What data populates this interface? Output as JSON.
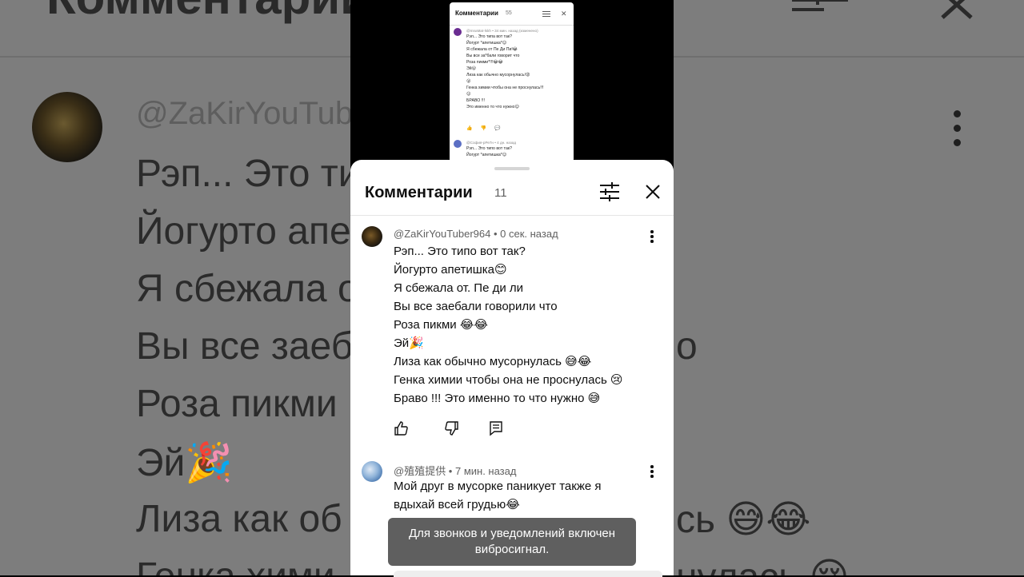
{
  "background": {
    "title": "Комментарии",
    "handle": "@ZaKirYouTub",
    "lines": [
      "Рэп... Это ти",
      "Йогурто апе",
      "Я сбежала о",
      "Вы все заеб",
      "Роза пикми",
      "Эй🎉",
      "Лиза как об",
      "Генка хими"
    ],
    "right_fragments": [
      "о",
      "сь 😅😂",
      "нулась 😢"
    ]
  },
  "mini_preview": {
    "title": "Комментарии",
    "count": "55",
    "comment1": {
      "meta": "@InnaMat-lskh • 34 мин. назад (изменено)",
      "lines": [
        "Рэп... Это типа вот так?",
        "Йогурт *апетишка*😊",
        "Я сбежала от Пе Ди Пи!😂",
        "Вы все за*бали говорит что",
        "Роза пикми*!!!😂😂",
        "Эй😮",
        "Лиза как обычно мусорнулась!😡",
        "😮",
        "Генка химии чтобы она не проснулась!!!",
        "😊",
        "БРАВО !!!",
        "Это именно то что нужно😊"
      ]
    },
    "comment2": {
      "meta": "@София-рРе7н • 4 дн. назад",
      "lines": [
        "Рэп... Это типо вот так?",
        "Йогурт *апетишка*😊"
      ]
    }
  },
  "sheet": {
    "title": "Комментарии",
    "count": "11"
  },
  "comments": [
    {
      "meta": "@ZaKirYouTuber964 • 0 сек. назад",
      "lines": [
        "Рэп... Это типо вот так?",
        "Йогурто апетишка😊",
        "Я сбежала от. Пе ди ли",
        "Вы все заебали говорили что",
        "Роза пикми 😂😂",
        "Эй🎉",
        "Лиза как обычно мусорнулась 😅😂",
        "Генка химии чтобы она не проснулась 😢",
        "Браво !!! Это именно то что нужно 😅"
      ]
    },
    {
      "meta": "@殖殖提供 • 7 мин. назад",
      "lines": [
        "Мой друг в мусорке паникует также я",
        "вдыхай всей грудью😂"
      ]
    }
  ],
  "toast": {
    "line1": "Для звонков и уведомлений включен",
    "line2": "вибросигнал."
  },
  "colors": {
    "toast_bg": "#5f5f5f",
    "meta_text": "#606060",
    "dim_bg": "#7d7d7d"
  }
}
